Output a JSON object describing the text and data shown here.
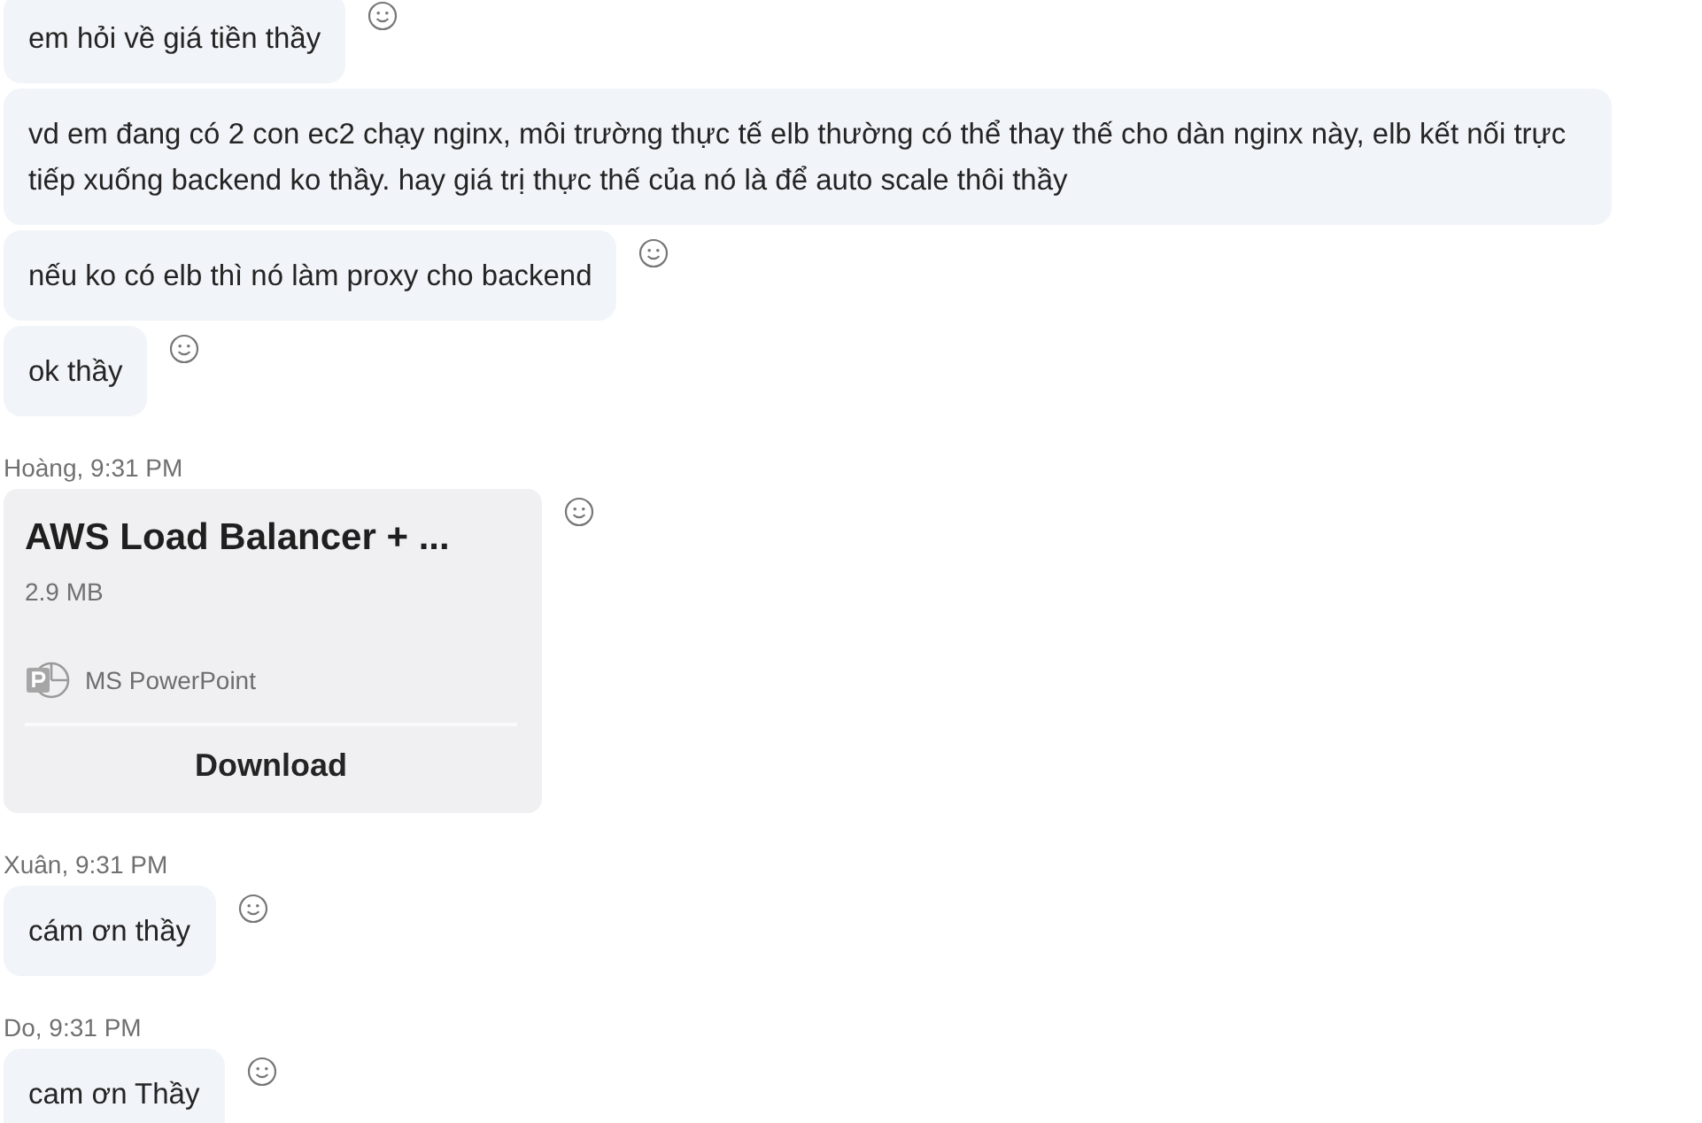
{
  "messages": [
    {
      "kind": "text",
      "text": "em hỏi về giá tiền thầy",
      "reaction_icon": true
    },
    {
      "kind": "text",
      "text": "vd em đang có 2 con ec2 chạy nginx, môi trường thực tế elb thường có thể thay thế cho dàn nginx này, elb kết nối trực tiếp xuống backend ko thầy. hay giá trị thực thế của nó là để auto scale thôi thầy",
      "reaction_icon": false
    },
    {
      "kind": "text",
      "text": "nếu ko có elb thì nó làm proxy cho backend",
      "reaction_icon": true
    },
    {
      "kind": "text",
      "text": "ok thầy",
      "reaction_icon": true
    },
    {
      "kind": "header",
      "text": "Hoàng, 9:31 PM"
    },
    {
      "kind": "file",
      "title": "AWS Load Balancer + ...",
      "size": "2.9 MB",
      "app": "MS PowerPoint",
      "action": "Download",
      "reaction_icon": true
    },
    {
      "kind": "header",
      "text": "Xuân, 9:31 PM"
    },
    {
      "kind": "text",
      "text": "cám ơn thầy",
      "reaction_icon": true
    },
    {
      "kind": "header",
      "text": "Do, 9:31 PM"
    },
    {
      "kind": "text",
      "text": "cam ơn Thầy",
      "reaction_icon": true
    }
  ]
}
